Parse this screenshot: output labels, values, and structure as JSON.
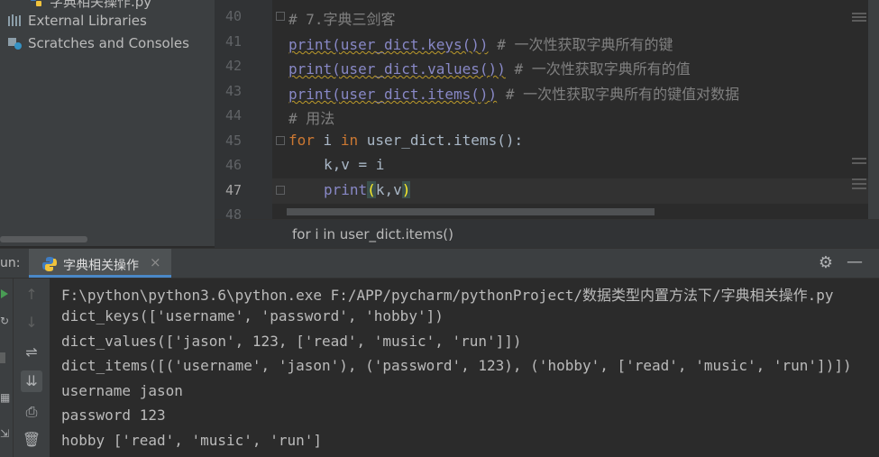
{
  "project_tree": {
    "partial_file": "字典相关操作.py",
    "external_libraries": "External Libraries",
    "scratches": "Scratches and Consoles"
  },
  "editor": {
    "line_numbers": [
      "40",
      "41",
      "42",
      "43",
      "44",
      "45",
      "46",
      "47",
      "48"
    ],
    "lines": {
      "l40": "# 7.字典三剑客",
      "l41_code": "print(user_dict.keys())",
      "l41_comment": " # 一次性获取字典所有的键",
      "l42_code": "print(user_dict.values())",
      "l42_comment": " # 一次性获取字典所有的值",
      "l43_code": "print(user_dict.items())",
      "l43_comment": " # 一次性获取字典所有的键值对数据",
      "l44": "# 用法",
      "l45_for": "for",
      "l45_i": " i ",
      "l45_in": "in",
      "l45_rest": " user_dict.items():",
      "l46": "k,v = i",
      "l47_print": "print",
      "l47_open": "(",
      "l47_args": "k,v",
      "l47_close": ")"
    }
  },
  "breadcrumb": "for i in user_dict.items()",
  "run": {
    "label": "un:",
    "tab_title": "字典相关操作",
    "close_symbol": "×",
    "output": [
      "F:\\python\\python3.6\\python.exe F:/APP/pycharm/pythonProject/数据类型内置方法下/字典相关操作.py",
      "dict_keys(['username', 'password', 'hobby'])",
      "dict_values(['jason', 123, ['read', 'music', 'run']])",
      "dict_items([('username', 'jason'), ('password', 123), ('hobby', ['read', 'music', 'run'])])",
      "username jason",
      "password 123",
      "hobby ['read', 'music', 'run']"
    ]
  },
  "icons": {
    "gear": "gear-icon",
    "minimize": "minimize-icon",
    "rerun": "rerun-icon",
    "up": "arrow-up-icon",
    "down": "arrow-down-icon",
    "wrap": "soft-wrap-icon",
    "scroll_end": "scroll-to-end-icon",
    "print": "print-icon",
    "trash": "trash-icon"
  },
  "colors": {
    "keyword": "#cc7832",
    "builtin": "#8888c6",
    "comment": "#808080",
    "accent": "#4a88c7"
  }
}
